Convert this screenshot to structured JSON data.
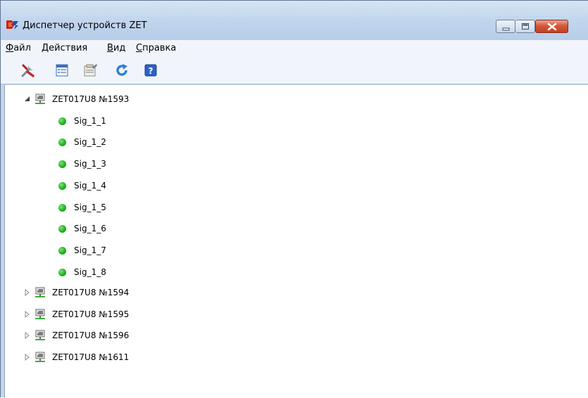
{
  "window": {
    "title": "Диспетчер устройств ZET"
  },
  "menu": {
    "items": [
      {
        "underline": "Ф",
        "rest": "айл"
      },
      {
        "underline": "Д",
        "rest": "ействия"
      },
      {
        "underline": "В",
        "rest": "ид"
      },
      {
        "underline": "С",
        "rest": "правка"
      }
    ]
  },
  "toolbar": {
    "buttons": [
      "tools-icon",
      "properties-icon",
      "device-config-icon",
      "refresh-icon",
      "help-icon"
    ]
  },
  "tree": {
    "expanded_device": {
      "label": "ZET017U8 №1593",
      "expanded": true,
      "channels": [
        "Sig_1_1",
        "Sig_1_2",
        "Sig_1_3",
        "Sig_1_4",
        "Sig_1_5",
        "Sig_1_6",
        "Sig_1_7",
        "Sig_1_8"
      ],
      "channel_status_color": "#1fb21f"
    },
    "collapsed_devices": [
      "ZET017U8 №1594",
      "ZET017U8 №1595",
      "ZET017U8 №1596",
      "ZET017U8 №1611"
    ]
  }
}
